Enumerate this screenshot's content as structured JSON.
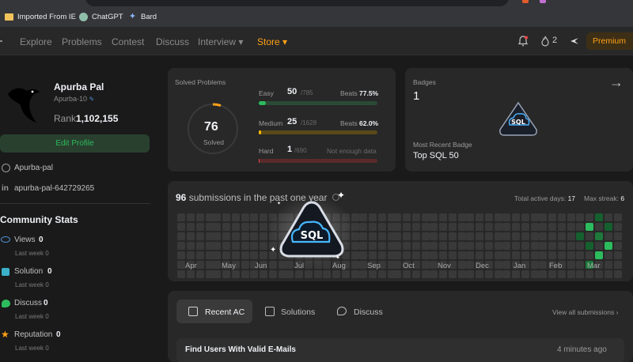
{
  "bookmarks": [
    {
      "label": "Imported From IE",
      "icon": "folder-icon"
    },
    {
      "label": "ChatGPT",
      "icon": "chatgpt-icon"
    },
    {
      "label": "Bard",
      "icon": "bard-icon"
    }
  ],
  "nav": {
    "items": [
      "Explore",
      "Problems",
      "Contest",
      "Discuss",
      "Interview ▾",
      "Store ▾"
    ],
    "streak": "2",
    "premium": "Premium"
  },
  "profile": {
    "name": "Apurba Pal",
    "username": "Apurba-10",
    "rank_label": "Rank",
    "rank": "1,102,155",
    "edit": "Edit Profile",
    "github": "Apurba-pal",
    "linkedin": "apurba-pal-642729265"
  },
  "community": {
    "title": "Community Stats",
    "last_week": "Last week",
    "items": [
      {
        "label": "Views",
        "value": "0",
        "last": "0",
        "color": "#4e8fd1"
      },
      {
        "label": "Solution",
        "value": "0",
        "last": "0",
        "color": "#3ab0c9"
      },
      {
        "label": "Discuss",
        "value": "0",
        "last": "0",
        "color": "#2cbb5d"
      },
      {
        "label": "Reputation",
        "value": "0",
        "last": "0",
        "color": "#ffa116"
      }
    ]
  },
  "solved": {
    "title": "Solved Problems",
    "total": "76",
    "total_label": "Solved",
    "rows": [
      {
        "label": "Easy",
        "solved": "50",
        "total": "/785",
        "beats_label": "Beats",
        "beats": "77.5%",
        "progress": 0.0637,
        "color": "#2cbb5d",
        "track": "#2a4a36"
      },
      {
        "label": "Medium",
        "solved": "25",
        "total": "/1628",
        "beats_label": "Beats",
        "beats": "62.0%",
        "progress": 0.0154,
        "color": "#ffb800",
        "track": "#5a4a1a"
      },
      {
        "label": "Hard",
        "solved": "1",
        "total": "/690",
        "beats_label": "",
        "beats": "Not enough data",
        "progress": 0.0014,
        "color": "#ef4743",
        "track": "#5a2a2a"
      }
    ]
  },
  "badges": {
    "title": "Badges",
    "count": "1",
    "recent_label": "Most Recent Badge",
    "recent": "Top SQL 50",
    "badge_text": "SQL"
  },
  "submissions": {
    "count": "96",
    "text": "submissions in the past one year",
    "active_label": "Total active days:",
    "active": "17",
    "streak_label": "Max streak:",
    "streak": "6",
    "months": [
      "Apr",
      "May",
      "Jun",
      "Jul",
      "Aug",
      "Sep",
      "Oct",
      "Nov",
      "Dec",
      "Jan",
      "Feb",
      "Mar"
    ]
  },
  "tabs": {
    "items": [
      "Recent AC",
      "Solutions",
      "Discuss"
    ],
    "view_all": "View all submissions"
  },
  "recent": [
    {
      "title": "Find Users With Valid E-Mails",
      "time": "4 minutes ago"
    }
  ]
}
